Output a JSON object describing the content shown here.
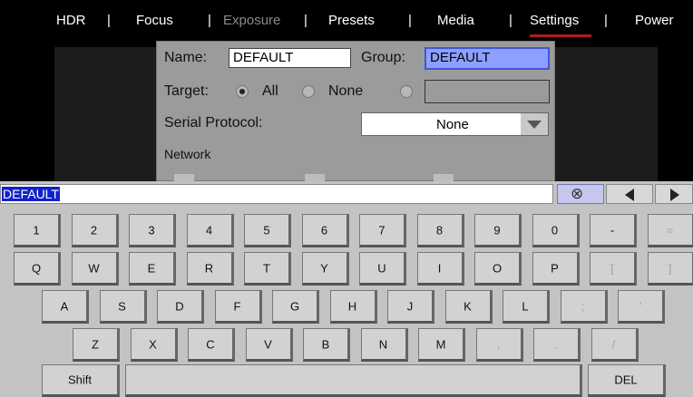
{
  "nav": {
    "tabs": [
      {
        "label": "HDR"
      },
      {
        "label": "Focus"
      },
      {
        "label": "Exposure"
      },
      {
        "label": "Presets"
      },
      {
        "label": "Media"
      },
      {
        "label": "Settings"
      },
      {
        "label": "Power"
      }
    ],
    "separator": "|",
    "active_tab": "Settings",
    "disabled_tab": "Exposure",
    "active_color": "#b31b1b"
  },
  "dialog": {
    "name_label": "Name:",
    "name_value": "DEFAULT",
    "group_label": "Group:",
    "group_value": "DEFAULT",
    "target_label": "Target:",
    "target_all": "All",
    "target_none": "None",
    "target_selected": "All",
    "serial_label": "Serial Protocol:",
    "serial_value": "None",
    "network_label": "Network"
  },
  "keyboard": {
    "input_value": "DEFAULT",
    "clear_glyph": "⊗",
    "row1": [
      "1",
      "2",
      "3",
      "4",
      "5",
      "6",
      "7",
      "8",
      "9",
      "0",
      "-",
      "="
    ],
    "row2": [
      "Q",
      "W",
      "E",
      "R",
      "T",
      "Y",
      "U",
      "I",
      "O",
      "P",
      "[",
      "]"
    ],
    "row3": [
      "A",
      "S",
      "D",
      "F",
      "G",
      "H",
      "J",
      "K",
      "L",
      ";",
      "'"
    ],
    "row4": [
      "Z",
      "X",
      "C",
      "V",
      "B",
      "N",
      "M",
      ",",
      ".",
      "/"
    ],
    "shift": "Shift",
    "del": "DEL",
    "selection_color": "#1122cc"
  }
}
